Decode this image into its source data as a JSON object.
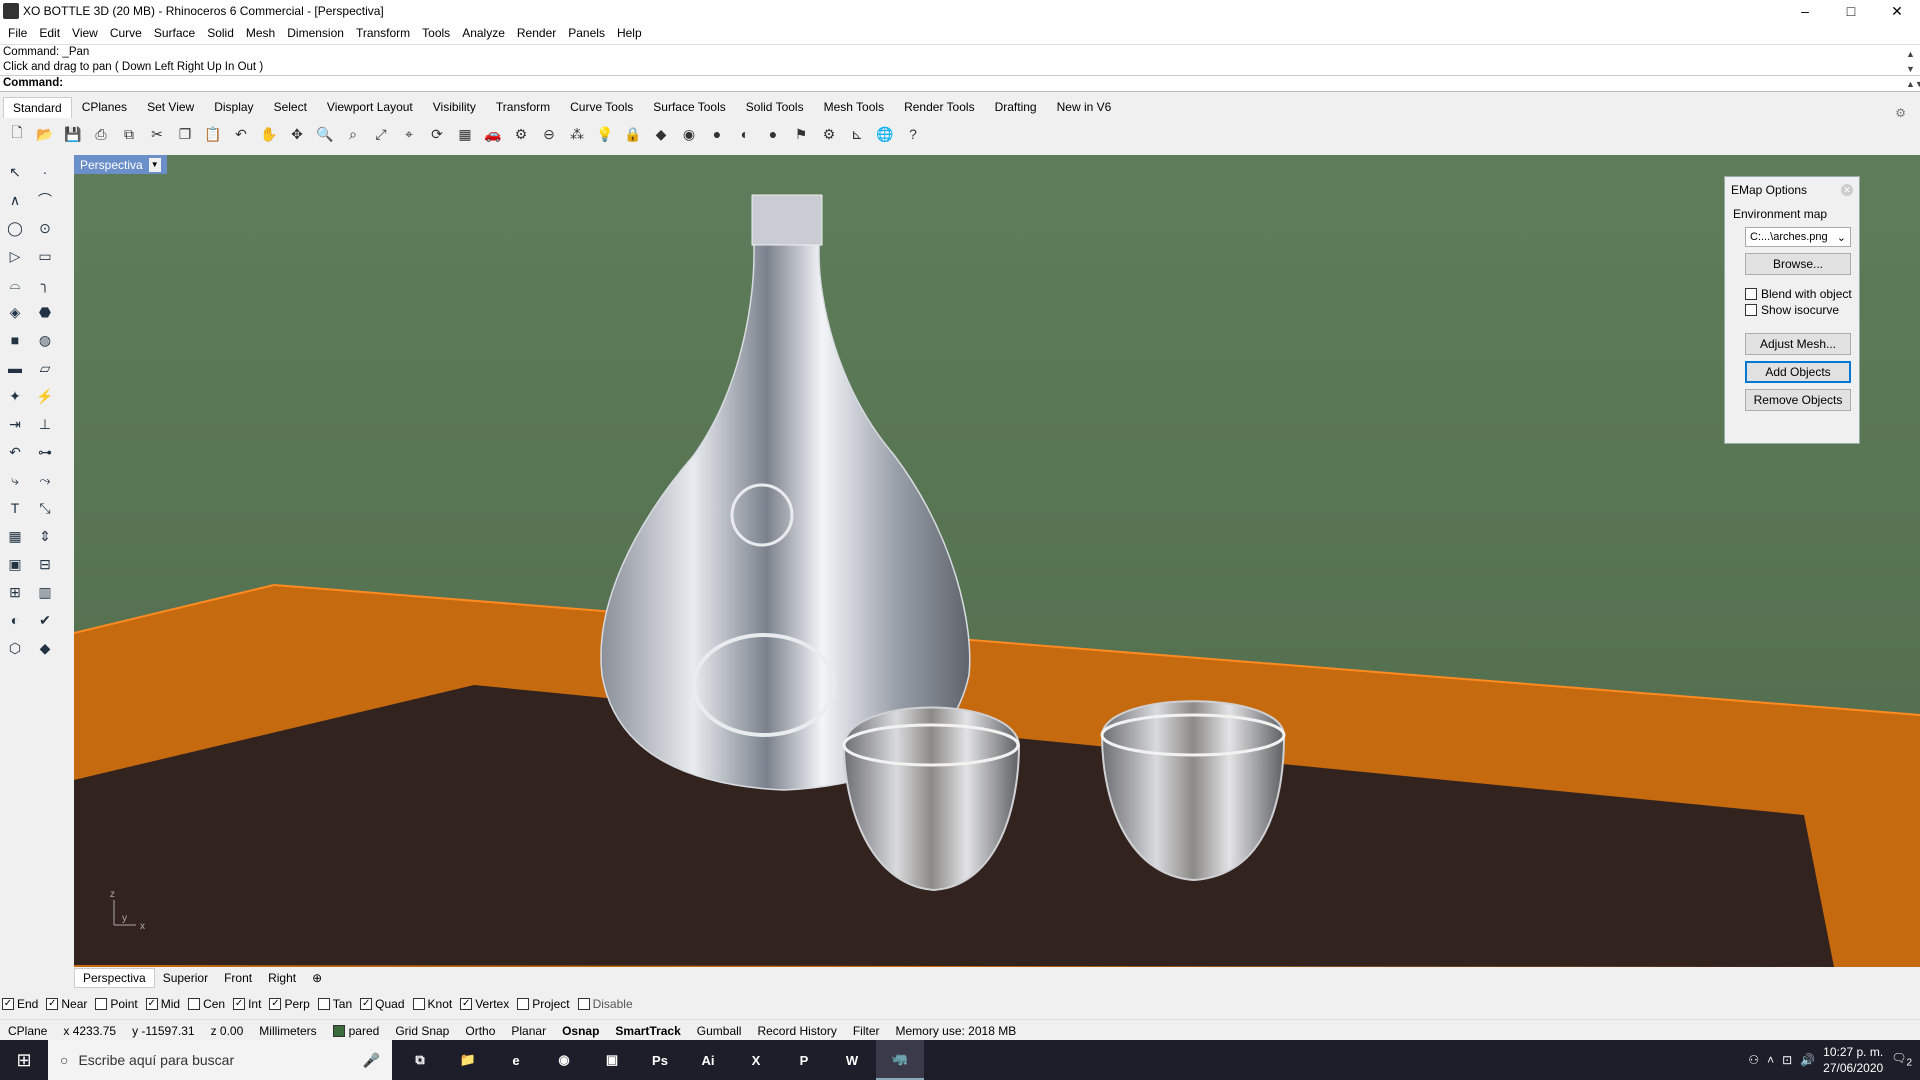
{
  "window": {
    "title": "XO BOTTLE 3D (20 MB) - Rhinoceros 6 Commercial - [Perspectiva]",
    "controls": [
      "–",
      "□",
      "✕"
    ]
  },
  "menu": [
    "File",
    "Edit",
    "View",
    "Curve",
    "Surface",
    "Solid",
    "Mesh",
    "Dimension",
    "Transform",
    "Tools",
    "Analyze",
    "Render",
    "Panels",
    "Help"
  ],
  "command": {
    "history1": "Command: _Pan",
    "history2": "Click and drag to pan ( Down  Left  Right  Up  In  Out )",
    "prompt": "Command:"
  },
  "toolbar_tabs": [
    "Standard",
    "CPlanes",
    "Set View",
    "Display",
    "Select",
    "Viewport Layout",
    "Visibility",
    "Transform",
    "Curve Tools",
    "Surface Tools",
    "Solid Tools",
    "Mesh Tools",
    "Render Tools",
    "Drafting",
    "New in V6"
  ],
  "toolbar_icons": [
    {
      "name": "new-icon",
      "glyph": "🗋"
    },
    {
      "name": "open-icon",
      "glyph": "📂"
    },
    {
      "name": "save-icon",
      "glyph": "💾"
    },
    {
      "name": "print-icon",
      "glyph": "⎙"
    },
    {
      "name": "copy-to-clipboard-icon",
      "glyph": "⧉"
    },
    {
      "name": "cut-icon",
      "glyph": "✂"
    },
    {
      "name": "copy-icon",
      "glyph": "❐"
    },
    {
      "name": "paste-icon",
      "glyph": "📋"
    },
    {
      "name": "undo-icon",
      "glyph": "↶"
    },
    {
      "name": "pan-icon",
      "glyph": "✋"
    },
    {
      "name": "move-view-icon",
      "glyph": "✥"
    },
    {
      "name": "zoom-icon",
      "glyph": "🔍"
    },
    {
      "name": "zoom-window-icon",
      "glyph": "⌕"
    },
    {
      "name": "zoom-extents-icon",
      "glyph": "⤢"
    },
    {
      "name": "zoom-selected-icon",
      "glyph": "⌖"
    },
    {
      "name": "rotate-view-icon",
      "glyph": "⟳"
    },
    {
      "name": "viewport-grid-icon",
      "glyph": "▦"
    },
    {
      "name": "car-icon",
      "glyph": "🚗"
    },
    {
      "name": "select-icon",
      "glyph": "⚙"
    },
    {
      "name": "cplane-icon",
      "glyph": "⊖"
    },
    {
      "name": "points-icon",
      "glyph": "⁂"
    },
    {
      "name": "light-icon",
      "glyph": "💡"
    },
    {
      "name": "lock-icon",
      "glyph": "🔒"
    },
    {
      "name": "layer-icon",
      "glyph": "◆"
    },
    {
      "name": "color-wheel-icon",
      "glyph": "◉"
    },
    {
      "name": "sphere-shade-icon",
      "glyph": "●"
    },
    {
      "name": "sphere-render-icon",
      "glyph": "◐"
    },
    {
      "name": "sphere-blue-icon",
      "glyph": "●"
    },
    {
      "name": "filter-icon",
      "glyph": "⚑"
    },
    {
      "name": "options-icon",
      "glyph": "⚙"
    },
    {
      "name": "dimension-icon",
      "glyph": "⊾"
    },
    {
      "name": "globe-icon",
      "glyph": "🌐"
    },
    {
      "name": "help-icon",
      "glyph": "?"
    }
  ],
  "left_tools": [
    "select-arrow-icon",
    "point-icon",
    "polyline-icon",
    "control-point-curve-icon",
    "circle-icon",
    "ellipse-icon",
    "polygon-icon",
    "rectangle-icon",
    "arc-icon",
    "fillet-icon",
    "surface-edge-icon",
    "loft-icon",
    "box-icon",
    "boolean-icon",
    "extrude-icon",
    "mesh-icon",
    "explode-icon",
    "split-icon",
    "move-icon",
    "trim-icon",
    "group-icon",
    "join-icon",
    "curve-fillet-icon",
    "blend-icon",
    "text-icon",
    "transform-icon",
    "array-icon",
    "align-icon",
    "dimension-left-icon",
    "hatch-icon",
    "grid-icon",
    "analyze-icon",
    "render-icon",
    "check-icon",
    "mass-icon",
    "properties-icon"
  ],
  "viewport": {
    "label": "Perspectiva",
    "colors": {
      "background": "#5c7a58",
      "table_top": "#c66a10",
      "table_shadow": "#33231f"
    }
  },
  "emap": {
    "title": "EMap Options",
    "section": "Environment map",
    "file": "C:...\\arches.png",
    "browse": "Browse...",
    "blend": "Blend with object",
    "isocurve": "Show isocurve",
    "adjust": "Adjust Mesh...",
    "add": "Add Objects",
    "remove": "Remove Objects"
  },
  "viewport_tabs": [
    "Perspectiva",
    "Superior",
    "Front",
    "Right"
  ],
  "osnap": [
    {
      "label": "End",
      "checked": true
    },
    {
      "label": "Near",
      "checked": true
    },
    {
      "label": "Point",
      "checked": false
    },
    {
      "label": "Mid",
      "checked": true
    },
    {
      "label": "Cen",
      "checked": false
    },
    {
      "label": "Int",
      "checked": true
    },
    {
      "label": "Perp",
      "checked": true
    },
    {
      "label": "Tan",
      "checked": false
    },
    {
      "label": "Quad",
      "checked": true
    },
    {
      "label": "Knot",
      "checked": false
    },
    {
      "label": "Vertex",
      "checked": true
    },
    {
      "label": "Project",
      "checked": false
    },
    {
      "label": "Disable",
      "checked": false
    }
  ],
  "status": {
    "cplane": "CPlane",
    "x": "x 4233.75",
    "y": "y -11597.31",
    "z": "z 0.00",
    "units": "Millimeters",
    "layer": "pared",
    "grid_snap": "Grid Snap",
    "ortho": "Ortho",
    "planar": "Planar",
    "osnap": "Osnap",
    "smarttrack": "SmartTrack",
    "gumball": "Gumball",
    "record": "Record History",
    "filter": "Filter",
    "memory": "Memory use: 2018 MB"
  },
  "taskbar": {
    "search_placeholder": "Escribe aquí para buscar",
    "time": "10:27 p. m.",
    "date": "27/06/2020",
    "notifications": "2",
    "apps": [
      {
        "name": "task-view-icon",
        "glyph": "⧉"
      },
      {
        "name": "file-explorer-icon",
        "glyph": "📁"
      },
      {
        "name": "edge-icon",
        "glyph": "e"
      },
      {
        "name": "chrome-icon",
        "glyph": "◉"
      },
      {
        "name": "app-icon",
        "glyph": "▣"
      },
      {
        "name": "photoshop-icon",
        "glyph": "Ps"
      },
      {
        "name": "illustrator-icon",
        "glyph": "Ai"
      },
      {
        "name": "excel-icon",
        "glyph": "X"
      },
      {
        "name": "powerpoint-icon",
        "glyph": "P"
      },
      {
        "name": "word-icon",
        "glyph": "W"
      },
      {
        "name": "rhino-icon",
        "glyph": "🦏"
      }
    ]
  }
}
